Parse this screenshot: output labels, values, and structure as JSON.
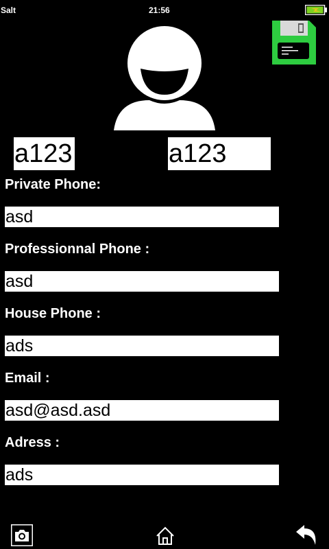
{
  "status": {
    "carrier": "Salt",
    "time": "21:56",
    "battery": 1.0
  },
  "contact": {
    "first_name": "a123",
    "last_name": "a123"
  },
  "fields": [
    {
      "label": "Private Phone:",
      "value": "asd"
    },
    {
      "label": "Professionnal Phone :",
      "value": "asd"
    },
    {
      "label": "House Phone :",
      "value": "ads"
    },
    {
      "label": "Email :",
      "value": "asd@asd.asd"
    },
    {
      "label": "Adress :",
      "value": "ads"
    }
  ],
  "icons": {
    "avatar": "user-avatar-icon",
    "save": "floppy-disk-icon",
    "camera": "camera-icon",
    "home": "home-icon",
    "back": "back-arrow-icon"
  },
  "colors": {
    "background": "#000000",
    "save_icon": "#2ecc40",
    "battery": "#7ed321"
  }
}
